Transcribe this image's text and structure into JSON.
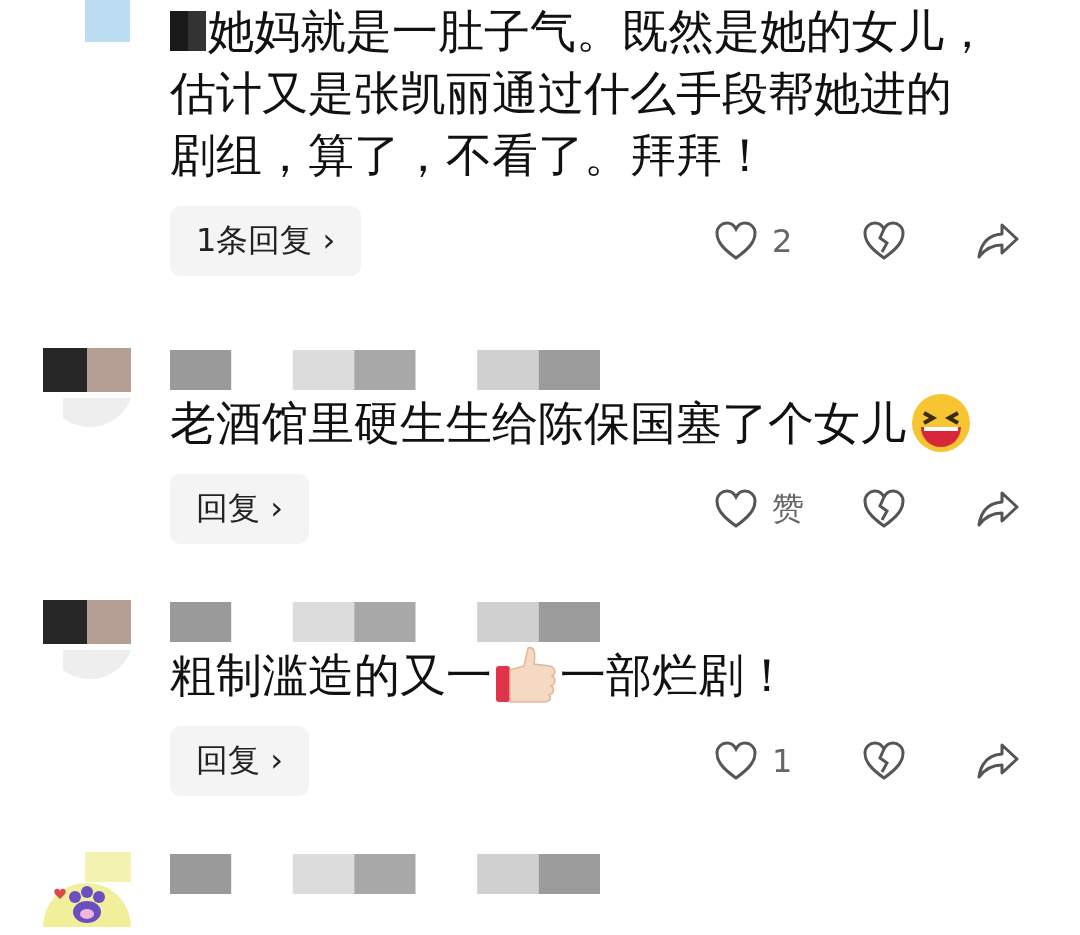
{
  "comments": [
    {
      "avatar": {
        "kind": "picture"
      },
      "lines": [
        [
          {
            "kind": "picture"
          },
          {
            "kind": "text",
            "text": "她妈就是一肚子气。既然是她的女儿，"
          }
        ],
        [
          {
            "kind": "text",
            "text": "估计又是张凯丽通过什么手段帮她进的"
          }
        ],
        [
          {
            "kind": "text",
            "text": "剧组，算了，不看了。拜拜！"
          }
        ]
      ],
      "reply_button": "1条回复 ›",
      "likes": "2"
    },
    {
      "avatar": {
        "kind": "picture"
      },
      "lines": [
        [
          {
            "kind": "text",
            "text": "老酒馆里硬生生给陈保国塞了个女儿"
          },
          {
            "kind": "laugh"
          }
        ]
      ],
      "reply_button": "回复 ›",
      "likes": "赞"
    },
    {
      "avatar": {
        "kind": "picture"
      },
      "lines": [
        [
          {
            "kind": "text",
            "text": "粗制滥造的又一"
          },
          {
            "kind": "thumb"
          },
          {
            "kind": "text",
            "text": "一部烂剧！"
          }
        ]
      ],
      "reply_button": "回复 ›",
      "likes": "1"
    },
    {
      "avatar": {
        "kind": "picture"
      }
    }
  ]
}
